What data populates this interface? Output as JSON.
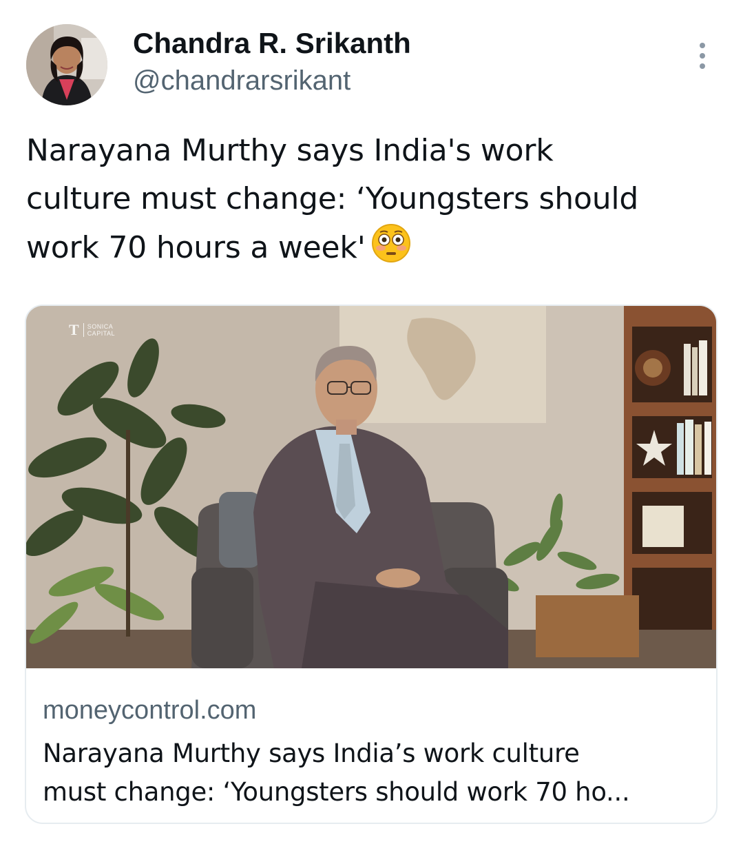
{
  "author": {
    "display_name": "Chandra R. Srikanth",
    "handle": "@chandrarsrikant"
  },
  "icons": {
    "more": "more-vertical-icon",
    "emoji": "flushed-face-emoji"
  },
  "tweet": {
    "text": "Narayana Murthy says India's work\nculture must change: ‘Youngsters should\nwork 70 hours a week'"
  },
  "card": {
    "watermark_line1": "SONICA",
    "watermark_line2": "CAPITAL",
    "domain": "moneycontrol.com",
    "title": "Narayana Murthy says India’s work culture\nmust change: ‘Youngsters should work 70 ho..."
  },
  "colors": {
    "text_primary": "#0f1419",
    "text_secondary": "#536471",
    "card_border": "#e6ecf0"
  }
}
